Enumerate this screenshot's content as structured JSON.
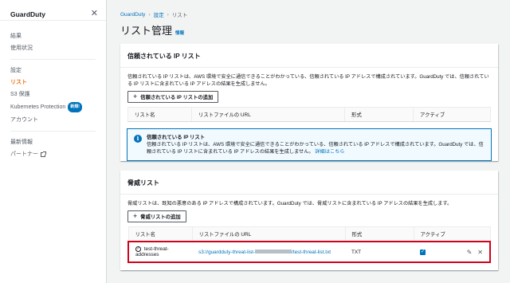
{
  "sidebar": {
    "title": "GuardDuty",
    "group1": [
      "結果",
      "使用状況"
    ],
    "group2": {
      "label": "設定",
      "items": [
        "リスト",
        "S3 保護",
        "Kubernetes Protection",
        "アカウント"
      ],
      "badge": "新規!"
    },
    "group3": {
      "label": "最新情報",
      "partner": "パートナー"
    }
  },
  "breadcrumb": [
    "GuardDuty",
    "設定",
    "リスト"
  ],
  "page": {
    "title": "リスト管理",
    "info": "情報"
  },
  "trusted": {
    "title": "信頼されている IP リスト",
    "desc": "信頼されている IP リストは、AWS 環境で安全に通信できることがわかっている、信頼されている IP アドレスで構成されています。GuardDuty では、信頼されている IP リストに含まれている IP アドレスの結果を生成しません。",
    "add_button": "信頼されている IP リストの追加",
    "columns": [
      "リスト名",
      "リストファイルの URL",
      "形式",
      "アクティブ"
    ],
    "alert_title": "信頼されている IP リスト",
    "alert_text": "信頼されている IP リストは、AWS 環境で安全に通信できることがわかっている、信頼されている IP アドレスで構成されています。GuardDuty では、信頼されている IP リストに含まれている IP アドレスの結果を生成しません。",
    "alert_link": "詳細はこちら"
  },
  "threat": {
    "title": "脅威リスト",
    "desc": "脅威リストは、既知の悪意のある IP アドレスで構成されています。GuardDuty では、脅威リストに含まれている IP アドレスの結果を生成します。",
    "add_button": "脅威リストの追加",
    "columns": [
      "リスト名",
      "リストファイルの URL",
      "形式",
      "アクティブ"
    ],
    "row": {
      "name": "test-threat-addresses",
      "url_prefix": "s3://guardduty-threat-list-",
      "url_suffix": "/test-threat-list.txt",
      "format": "TXT",
      "active": true
    }
  },
  "colors": {
    "accent": "#ec7211",
    "link": "#0073bb",
    "highlight": "#d0021b"
  }
}
